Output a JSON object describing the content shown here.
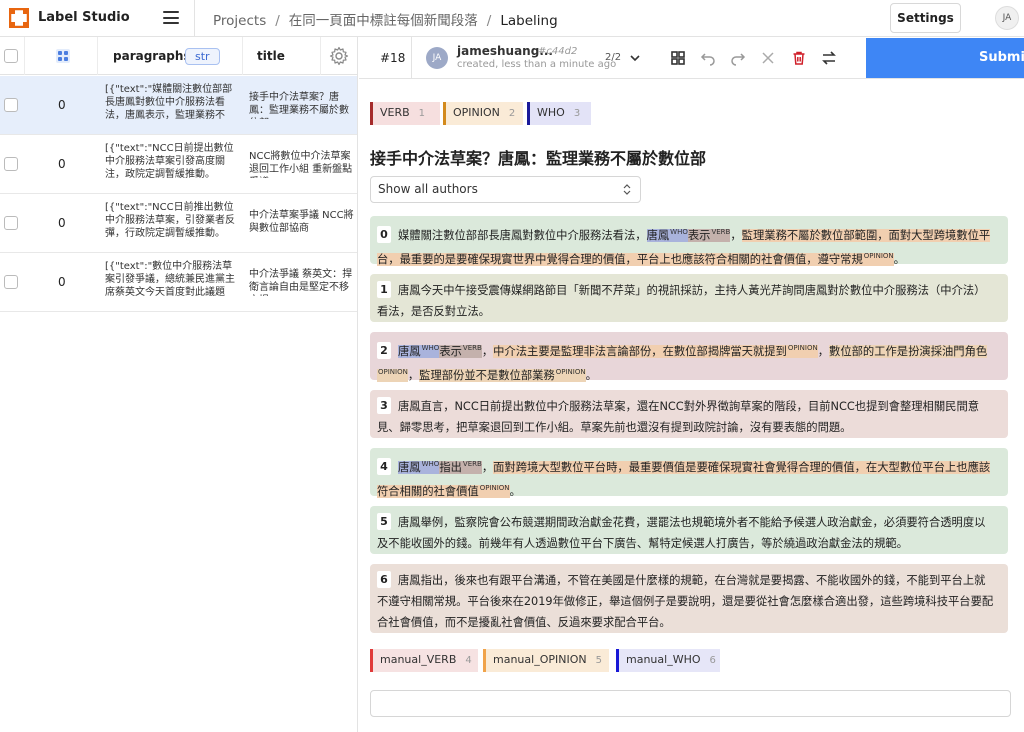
{
  "app": {
    "name": "Label Studio"
  },
  "breadcrumb": {
    "projects": "Projects",
    "project": "在同一頁面中標註每個新聞段落",
    "current": "Labeling",
    "sep": "/"
  },
  "header": {
    "settings_label": "Settings",
    "user_initials": "JA"
  },
  "table": {
    "columns": {
      "paragraphs": "paragraphs",
      "paragraphs_type": "str",
      "title": "title"
    },
    "rows": [
      {
        "count": "0",
        "paragraphs": "[{\"text\":\"媒體關注數位部部長唐鳳對數位中介服務法看法，唐鳳表示，監理業務不",
        "title": "接手中介法草案？唐鳳：監理業務不屬於數位部",
        "selected": true
      },
      {
        "count": "0",
        "paragraphs": "[{\"text\":\"NCC日前提出數位中介服務法草案引發高度關注，政院定調暫緩推動。",
        "title": "NCC將數位中介法草案退回工作小組 重新盤點爭議",
        "selected": false
      },
      {
        "count": "0",
        "paragraphs": "[{\"text\":\"NCC日前推出數位中介服務法草案，引發業者反彈，行政院定調暫緩推動。",
        "title": "中介法草案爭議 NCC將與數位部協商",
        "selected": false
      },
      {
        "count": "0",
        "paragraphs": "[{\"text\":\"數位中介服務法草案引發爭議，總統兼民進黨主席蔡英文今天首度對此議題",
        "title": "中介法爭議 蔡英文：捍衛言論自由是堅定不移立場",
        "selected": false
      }
    ]
  },
  "annotation": {
    "task_id": "#18",
    "user_initials": "JA",
    "user_name": "jameshuang...",
    "hash": "#c44d2",
    "created": "created, less than a minute ago",
    "count": "2/2",
    "submit_label": "Submit"
  },
  "labels": [
    {
      "name": "VERB",
      "hotkey": "1"
    },
    {
      "name": "OPINION",
      "hotkey": "2"
    },
    {
      "name": "WHO",
      "hotkey": "3"
    }
  ],
  "manual_labels": [
    {
      "name": "manual_VERB",
      "hotkey": "4"
    },
    {
      "name": "manual_OPINION",
      "hotkey": "5"
    },
    {
      "name": "manual_WHO",
      "hotkey": "6"
    }
  ],
  "article": {
    "title": "接手中介法草案？唐鳳：監理業務不屬於數位部",
    "author_filter": "Show all authors"
  },
  "paragraphs": [
    {
      "num": "0",
      "segments": [
        {
          "t": "媒體關注數位部部長唐鳳對數位中介服務法看法，"
        },
        {
          "t": "唐鳳",
          "hl": "who",
          "tag": "WHO"
        },
        {
          "t": "表示",
          "hl": "verb",
          "tag": "VERB"
        },
        {
          "t": "，"
        },
        {
          "t": "監理業務不屬於數位部範圍，面對大型跨境數位平台，最重要的是要確保現實世界中覺得合理的價值，平台上也應該符合相關的社會價值，遵守常規",
          "hl": "op",
          "tag": "OPINION"
        },
        {
          "t": "。"
        }
      ]
    },
    {
      "num": "1",
      "segments": [
        {
          "t": "唐鳳今天中午接受震傳媒網路節目「新聞不芹菜」的視訊採訪，主持人黃光芹詢問唐鳳對於數位中介服務法（中介法）看法，是否反對立法。"
        }
      ]
    },
    {
      "num": "2",
      "segments": [
        {
          "t": "唐鳳",
          "hl": "who",
          "tag": "WHO"
        },
        {
          "t": "表示",
          "hl": "verb",
          "tag": "VERB"
        },
        {
          "t": "，"
        },
        {
          "t": "中介法主要是監理非法言論部份，在數位部揭牌當天就提到",
          "hl": "op",
          "tag": "OPINION"
        },
        {
          "t": "，"
        },
        {
          "t": "數位部的工作是扮演採油門角色",
          "hl": "op",
          "tag": "OPINION"
        },
        {
          "t": "，"
        },
        {
          "t": "監理部份並不是數位部業務",
          "hl": "op",
          "tag": "OPINION"
        },
        {
          "t": "。"
        }
      ]
    },
    {
      "num": "3",
      "segments": [
        {
          "t": "唐鳳直言，NCC日前提出數位中介服務法草案，還在NCC對外界徵詢草案的階段，目前NCC也提到會整理相關民間意見、歸零思考，把草案退回到工作小組。草案先前也還沒有提到政院討論，沒有要表態的問題。"
        }
      ]
    },
    {
      "num": "4",
      "segments": [
        {
          "t": "唐鳳",
          "hl": "who",
          "tag": "WHO"
        },
        {
          "t": "指出",
          "hl": "verb",
          "tag": "VERB"
        },
        {
          "t": "，"
        },
        {
          "t": "面對跨境大型數位平台時，最重要價值是要確保現實社會覺得合理的價值，在大型數位平台上也應該符合相關的社會價值",
          "hl": "op",
          "tag": "OPINION"
        },
        {
          "t": "。"
        }
      ]
    },
    {
      "num": "5",
      "segments": [
        {
          "t": "唐鳳舉例，監察院會公布競選期間政治獻金花費，選罷法也規範境外者不能給予候選人政治獻金，必須要符合透明度以及不能收國外的錢。前幾年有人透過數位平台下廣告、幫特定候選人打廣告，等於繞過政治獻金法的規範。"
        }
      ]
    },
    {
      "num": "6",
      "segments": [
        {
          "t": "唐鳳指出，後來也有跟平台溝通，不管在美國是什麼樣的規範，在台灣就是要揭露、不能收國外的錢，不能到平台上就不遵守相關常規。平台後來在2019年做修正，舉這個例子是要說明，還是要從社會怎麼樣合適出發，這些跨境科技平台要配合社會價值，而不是擾亂社會價值、反過來要求配合平台。"
        }
      ]
    }
  ]
}
